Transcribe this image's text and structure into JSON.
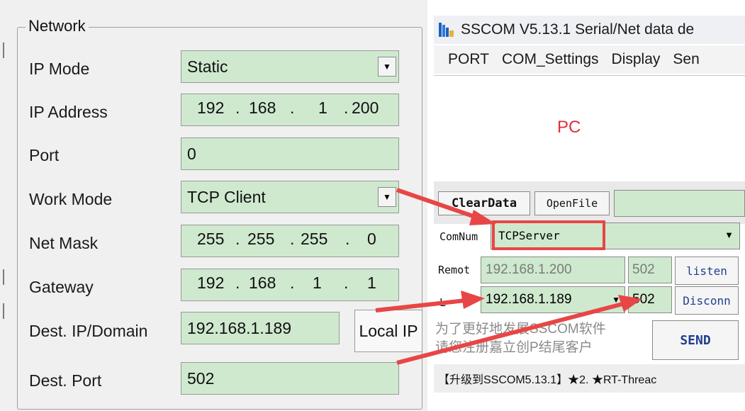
{
  "network": {
    "title": "Network",
    "ip_mode": {
      "label": "IP Mode",
      "value": "Static"
    },
    "ip_address": {
      "label": "IP Address",
      "octets": [
        "192",
        "168",
        "1",
        "200"
      ]
    },
    "port": {
      "label": "Port",
      "value": "0"
    },
    "work_mode": {
      "label": "Work Mode",
      "value": "TCP Client"
    },
    "net_mask": {
      "label": "Net Mask",
      "octets": [
        "255",
        "255",
        "255",
        "0"
      ]
    },
    "gateway": {
      "label": "Gateway",
      "octets": [
        "192",
        "168",
        "1",
        "1"
      ]
    },
    "dest_ip": {
      "label": "Dest. IP/Domain",
      "value": "192.168.1.189"
    },
    "local_ip_button": "Local IP",
    "dest_port": {
      "label": "Dest. Port",
      "value": "502"
    }
  },
  "sscom": {
    "title": "SSCOM V5.13.1 Serial/Net data de",
    "menu": [
      "PORT",
      "COM_Settings",
      "Display",
      "Sen"
    ],
    "receive_label": "PC",
    "clear_data": "ClearData",
    "open_file": "OpenFile",
    "comnum_label": "ComNum",
    "comnum_value": "TCPServer",
    "remote_label": "Remot",
    "remote_ip": "192.168.1.200",
    "remote_port": "502",
    "listen_button": "listen",
    "local_label": "L",
    "local_ip": "192.168.1.189",
    "local_port": "502",
    "disconnect_button": "Disconn",
    "promo_line1": "为了更好地发展SSCOM软件",
    "promo_line2": "请您注册嘉立创P结尾客户",
    "send_button": "SEND",
    "status_text": "【升级到SSCOM5.13.1】★2. ★RT-Threac"
  },
  "colors": {
    "field_green": "#cfe9cf",
    "annotation_red": "#e84646",
    "pc_label_red": "#e0303a"
  }
}
